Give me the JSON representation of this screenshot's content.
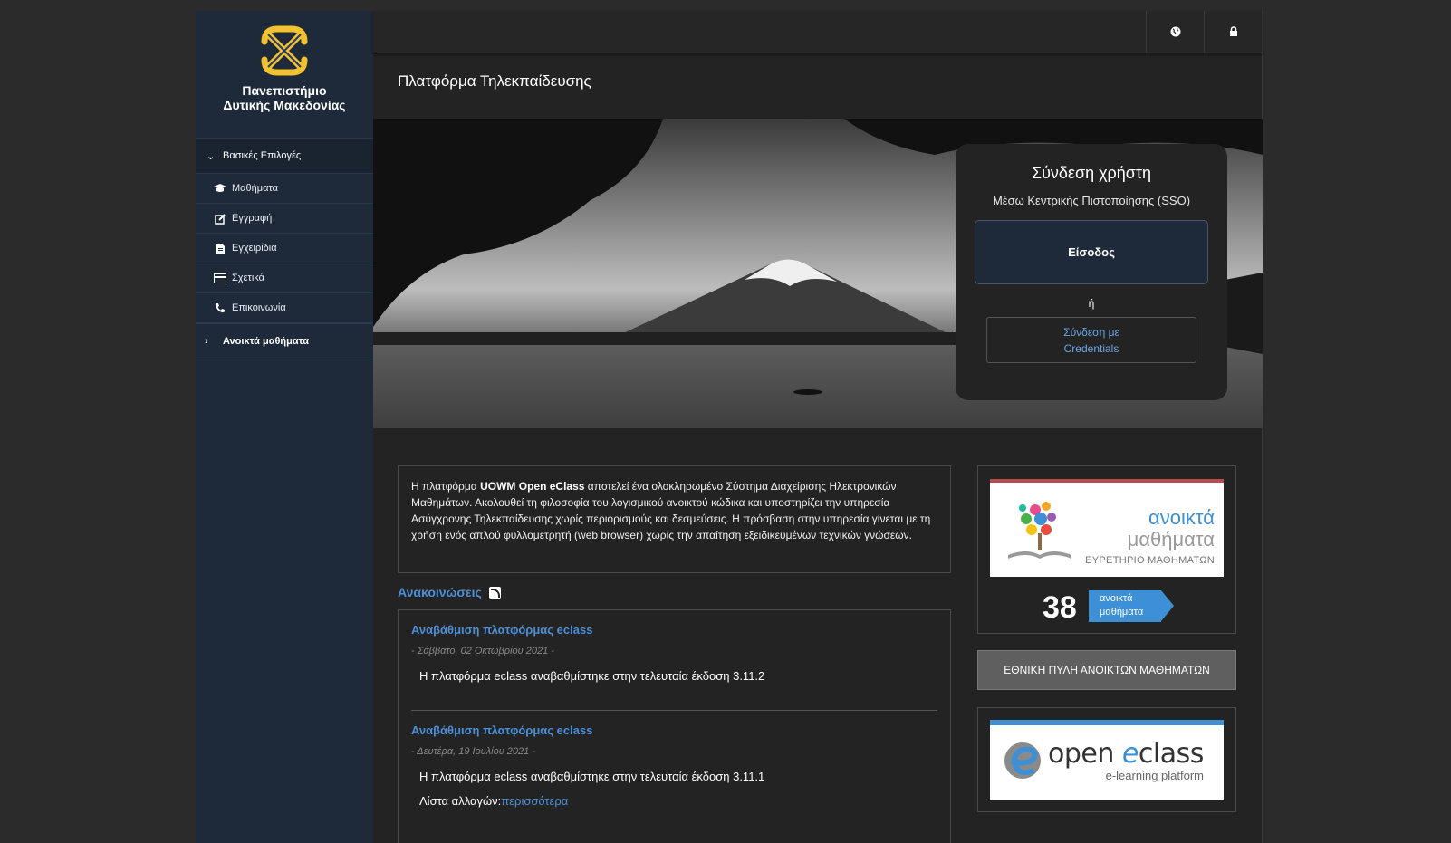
{
  "sidebar": {
    "logo_line1": "Πανεπιστήμιο",
    "logo_line2": "Δυτικής Μακεδονίας",
    "section_label": "Βασικές Επιλογές",
    "items": [
      {
        "label": "Μαθήματα",
        "icon": "graduation-cap-icon"
      },
      {
        "label": "Εγγραφή",
        "icon": "edit-icon"
      },
      {
        "label": "Εγχειρίδια",
        "icon": "document-icon"
      },
      {
        "label": "Σχετικά",
        "icon": "card-icon"
      },
      {
        "label": "Επικοινωνία",
        "icon": "phone-icon"
      }
    ],
    "open_courses_label": "Ανοικτά μαθήματα"
  },
  "topbar": {
    "globe_icon": "globe-icon",
    "lock_icon": "lock-icon"
  },
  "page_title": "Πλατφόρμα Τηλεκπαίδευσης",
  "login": {
    "title": "Σύνδεση χρήστη",
    "subtitle": "Μέσω Κεντρικής Πιστοποίησης (SSO)",
    "sso_button": "Είσοδος",
    "or": "ή",
    "cred_line1": "Σύνδεση με",
    "cred_line2": "Credentials"
  },
  "description": {
    "prefix": "Η πλατφόρμα ",
    "brand": "UOWM Open eClass",
    "text": " αποτελεί ένα ολοκληρωμένο Σύστημα Διαχείρισης Ηλεκτρονικών Μαθημάτων. Ακολουθεί τη φιλοσοφία του λογισμικού ανοικτού κώδικα και υποστηρίζει την υπηρεσία Ασύγχρονης Τηλεκπαίδευσης χωρίς περιορισμούς και δεσμεύσεις. Η πρόσβαση στην υπηρεσία γίνεται με τη χρήση ενός απλού φυλλομετρητή (web browser) χωρίς την απαίτηση εξειδικευμένων τεχνικών γνώσεων."
  },
  "announcements": {
    "header": "Ανακοινώσεις",
    "items": [
      {
        "title": "Αναβάθμιση πλατφόρμας eclass",
        "date": "- Σάββατο, 02 Οκτωβρίου 2021 -",
        "body": "Η πλατφόρμα eclass αναβαθμίστηκε στην τελευταία έκδοση 3.11.2"
      },
      {
        "title": "Αναβάθμιση πλατφόρμας eclass",
        "date": "- Δευτέρα, 19 Ιουλίου 2021 -",
        "body": "Η πλατφόρμα eclass αναβαθμίστηκε στην τελευταία έκδοση 3.11.1",
        "more_prefix": "Λίστα αλλαγών:",
        "more_link": "περισσότερα"
      }
    ]
  },
  "open_courses": {
    "word1": "ανοικτά",
    "word2": "μαθήματα",
    "word3": "ΕΥΡΕΤΗΡΙΟ ΜΑΘΗΜΑΤΩΝ",
    "count": "38",
    "badge_line1": "ανοικτά",
    "badge_line2": "μαθήματα"
  },
  "portal_button": "ΕΘΝΙΚΗ ΠΥΛΗ ΑΝΟΙΚΤΩΝ ΜΑΘΗΜΑΤΩΝ",
  "eclass_logo": {
    "word_a": "open ",
    "word_e": "e",
    "word_b": "class",
    "sub": "e-learning platform"
  },
  "colors": {
    "sidebar_bg": "#1e2a3a",
    "accent_blue": "#4c8fd6",
    "badge_blue": "#3d8fd6",
    "main_bg": "#232323"
  }
}
